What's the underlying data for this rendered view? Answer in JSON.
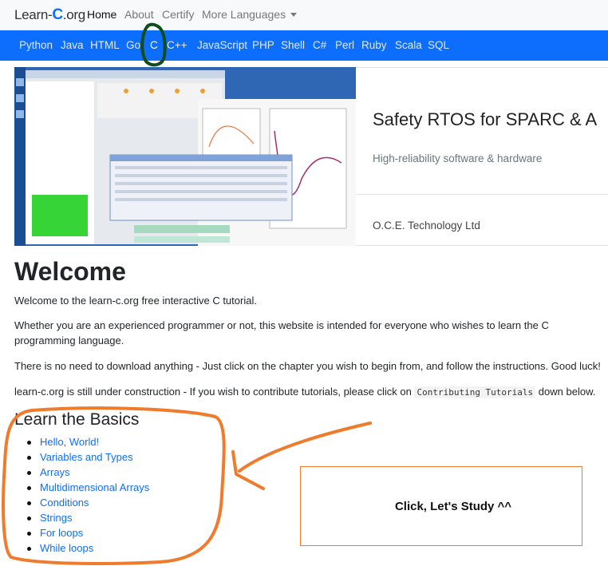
{
  "brand": {
    "prefix": "Learn-",
    "letter": "C",
    "suffix": ".org"
  },
  "topnav": {
    "home": "Home",
    "about": "About",
    "certify": "Certify",
    "more": "More Languages"
  },
  "languages": [
    "Python",
    "Java",
    "HTML",
    "Go",
    "C",
    "C++",
    "JavaScript",
    "PHP",
    "Shell",
    "C#",
    "Perl",
    "Ruby",
    "Scala",
    "SQL"
  ],
  "active_language": "C",
  "ad": {
    "title": "Safety RTOS for SPARC & A",
    "subtitle": "High-reliability software & hardware",
    "company": "O.C.E. Technology Ltd"
  },
  "welcome": {
    "heading": "Welcome",
    "p1": "Welcome to the learn-c.org free interactive C tutorial.",
    "p2": "Whether you are an experienced programmer or not, this website is intended for everyone who wishes to learn the C programming language.",
    "p3": "There is no need to download anything - Just click on the chapter you wish to begin from, and follow the instructions. Good luck!",
    "p4_before": "learn-c.org is still under construction - If you wish to contribute tutorials, please click on",
    "p4_code": "Contributing Tutorials",
    "p4_after": "down below."
  },
  "basics": {
    "heading": "Learn the Basics",
    "items": [
      "Hello, World!",
      "Variables and Types",
      "Arrays",
      "Multidimensional Arrays",
      "Conditions",
      "Strings",
      "For loops",
      "While loops"
    ]
  },
  "annotation": {
    "text": "Click, Let's Study ^^"
  },
  "colors": {
    "primary": "#0d6efd",
    "annotation_orange": "#f07b2c",
    "annotation_green": "#0f4d1a"
  }
}
